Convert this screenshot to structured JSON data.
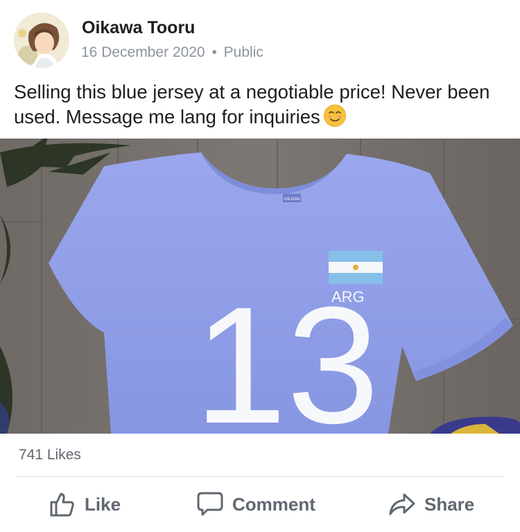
{
  "post": {
    "author": "Oikawa Tooru",
    "date": "16 December 2020",
    "separator": "•",
    "privacy": "Public",
    "text": "Selling this blue jersey at a negotiable price! Never been used. Message me lang for inquiries",
    "emoji": "smiling-face-emoji",
    "photo": {
      "jersey_number": "13",
      "country_code": "ARG",
      "tag_text": "GILDAN",
      "jersey_color": "#8f9ee8"
    }
  },
  "stats": {
    "likes": "741 Likes"
  },
  "actions": {
    "like_label": "Like",
    "comment_label": "Comment",
    "share_label": "Share"
  },
  "icons": {
    "like": "thumbs-up-icon",
    "comment": "speech-bubble-icon",
    "share": "share-arrow-icon"
  },
  "colors": {
    "text": "#1c1e21",
    "muted": "#8d949e",
    "action": "#606770",
    "divider": "#dadde1"
  }
}
